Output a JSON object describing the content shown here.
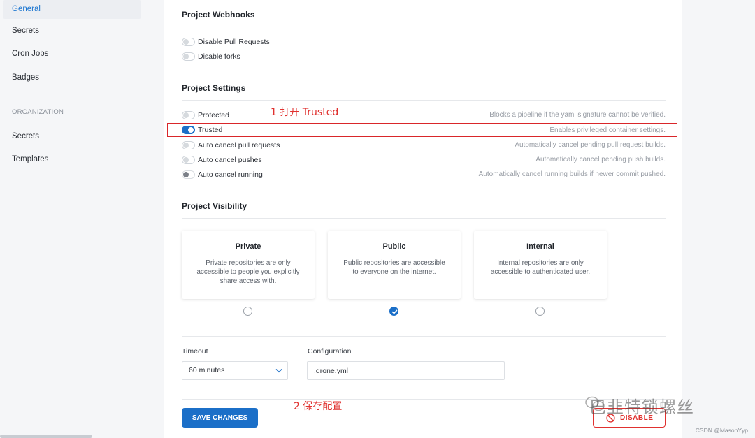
{
  "sidebar": {
    "items": [
      {
        "label": "General",
        "active": true
      },
      {
        "label": "Secrets"
      },
      {
        "label": "Cron Jobs"
      },
      {
        "label": "Badges"
      }
    ],
    "org_heading": "ORGANIZATION",
    "org_items": [
      {
        "label": "Secrets"
      },
      {
        "label": "Templates"
      }
    ]
  },
  "webhooks": {
    "title": "Project Webhooks",
    "options": [
      {
        "label": "Disable Pull Requests",
        "on": false
      },
      {
        "label": "Disable forks",
        "on": false
      }
    ]
  },
  "settings": {
    "title": "Project Settings",
    "options": [
      {
        "label": "Protected",
        "desc": "Blocks a pipeline if the yaml signature cannot be verified.",
        "on": false
      },
      {
        "label": "Trusted",
        "desc": "Enables privileged container settings.",
        "on": true
      },
      {
        "label": "Auto cancel pull requests",
        "desc": "Automatically cancel pending pull request builds.",
        "on": false
      },
      {
        "label": "Auto cancel pushes",
        "desc": "Automatically cancel pending push builds.",
        "on": false
      },
      {
        "label": "Auto cancel running",
        "desc": "Automatically cancel running builds if newer commit pushed.",
        "on": false
      }
    ]
  },
  "visibility": {
    "title": "Project Visibility",
    "options": [
      {
        "title": "Private",
        "desc": "Private repositories are only accessible to people you explicitly share access with.",
        "selected": false
      },
      {
        "title": "Public",
        "desc": "Public repositories are accessible to everyone on the internet.",
        "selected": true
      },
      {
        "title": "Internal",
        "desc": "Internal repositories are only accessible to authenticated user.",
        "selected": false
      }
    ]
  },
  "timeout": {
    "label": "Timeout",
    "value": "60 minutes"
  },
  "configuration": {
    "label": "Configuration",
    "value": ".drone.yml"
  },
  "buttons": {
    "save": "SAVE CHANGES",
    "disable": "DISABLE"
  },
  "annotations": {
    "step1": "1 打开 Trusted",
    "step2": "2 保存配置"
  },
  "watermark": {
    "text": "巴韭特锁螺丝",
    "credit": "CSDN @MasonYyp"
  },
  "colors": {
    "accent": "#1b6fc8",
    "annotation": "#e0312f",
    "danger": "#e0312f"
  }
}
